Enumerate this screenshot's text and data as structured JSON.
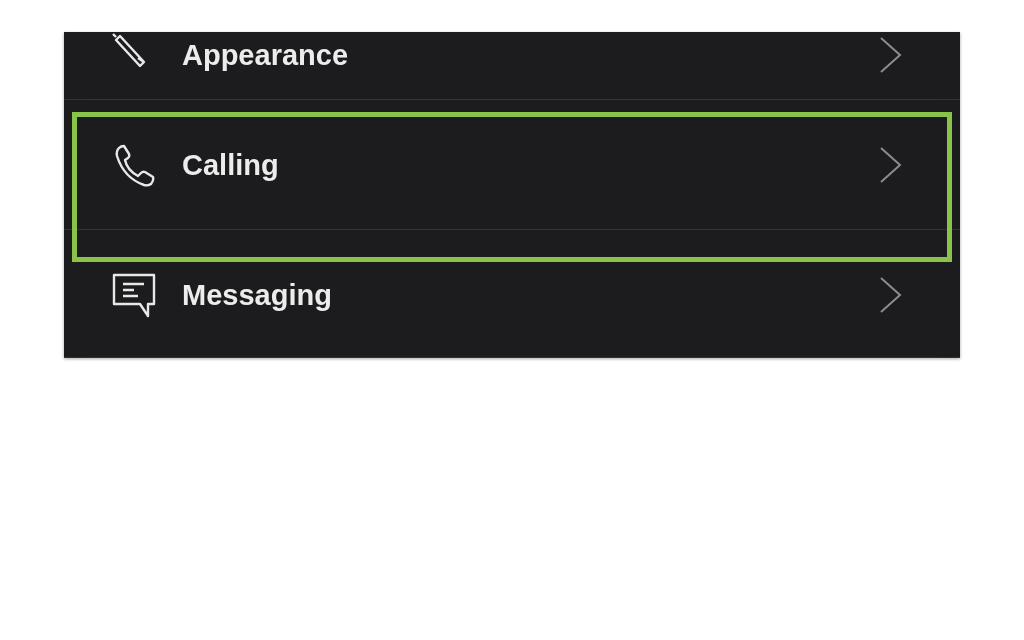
{
  "settings": [
    {
      "kind": "appearance",
      "label": "Appearance",
      "highlighted": false
    },
    {
      "kind": "calling",
      "label": "Calling",
      "highlighted": true
    },
    {
      "kind": "messaging",
      "label": "Messaging",
      "highlighted": false
    }
  ]
}
